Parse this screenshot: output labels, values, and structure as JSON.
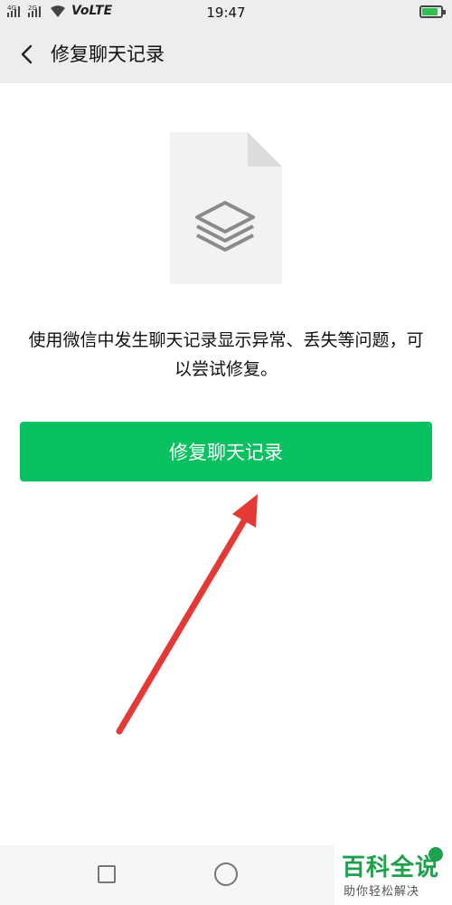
{
  "status_bar": {
    "network_1": "4G",
    "network_2": "2G",
    "volte": "VoLTE",
    "time": "19:47",
    "battery_level": 0.85,
    "battery_color": "#2fc14f"
  },
  "header": {
    "back_icon": "chevron-left-icon",
    "title": "修复聊天记录"
  },
  "main": {
    "illustration": "document-layers-icon",
    "description": "使用微信中发生聊天记录显示异常、丢失等问题，可以尝试修复。",
    "repair_button_label": "修复聊天记录",
    "button_color": "#07c160",
    "annotation_arrow_color": "#e53935"
  },
  "nav_bar": {
    "recent_icon": "square-icon",
    "home_icon": "circle-icon"
  },
  "watermark": {
    "logo_text": "百科全说",
    "subtitle": "助你轻松解决"
  }
}
